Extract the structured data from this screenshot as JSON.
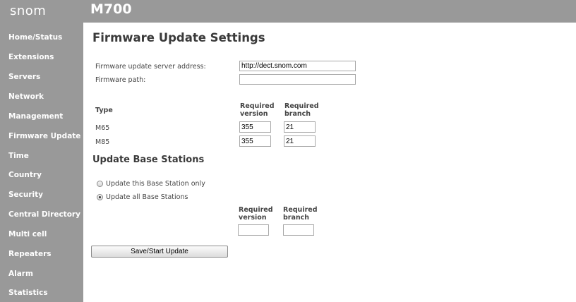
{
  "header": {
    "logo": "snom",
    "model": "M700"
  },
  "sidebar": {
    "items": [
      {
        "label": "Home/Status"
      },
      {
        "label": "Extensions"
      },
      {
        "label": "Servers"
      },
      {
        "label": "Network"
      },
      {
        "label": "Management"
      },
      {
        "label": "Firmware Update"
      },
      {
        "label": "Time"
      },
      {
        "label": "Country"
      },
      {
        "label": "Security"
      },
      {
        "label": "Central Directory"
      },
      {
        "label": "Multi cell"
      },
      {
        "label": "Repeaters"
      },
      {
        "label": "Alarm"
      },
      {
        "label": "Statistics"
      }
    ]
  },
  "main": {
    "title": "Firmware Update Settings",
    "server_address_label": "Firmware update server address:",
    "server_address_value": "http://dect.snom.com",
    "firmware_path_label": "Firmware path:",
    "firmware_path_value": "",
    "type_header": "Type",
    "col_version_line1": "Required",
    "col_version_line2": "version",
    "col_branch_line1": "Required",
    "col_branch_line2": "branch",
    "rows": [
      {
        "type": "M65",
        "version": "355",
        "branch": "21"
      },
      {
        "type": "M85",
        "version": "355",
        "branch": "21"
      }
    ]
  },
  "update_base": {
    "title": "Update Base Stations",
    "option_this": "Update this Base Station only",
    "option_all": "Update all Base Stations",
    "selected": "all",
    "col_version_line1": "Required",
    "col_version_line2": "version",
    "col_branch_line1": "Required",
    "col_branch_line2": "branch",
    "version_value": "",
    "branch_value": ""
  },
  "actions": {
    "save_label": "Save/Start Update"
  }
}
